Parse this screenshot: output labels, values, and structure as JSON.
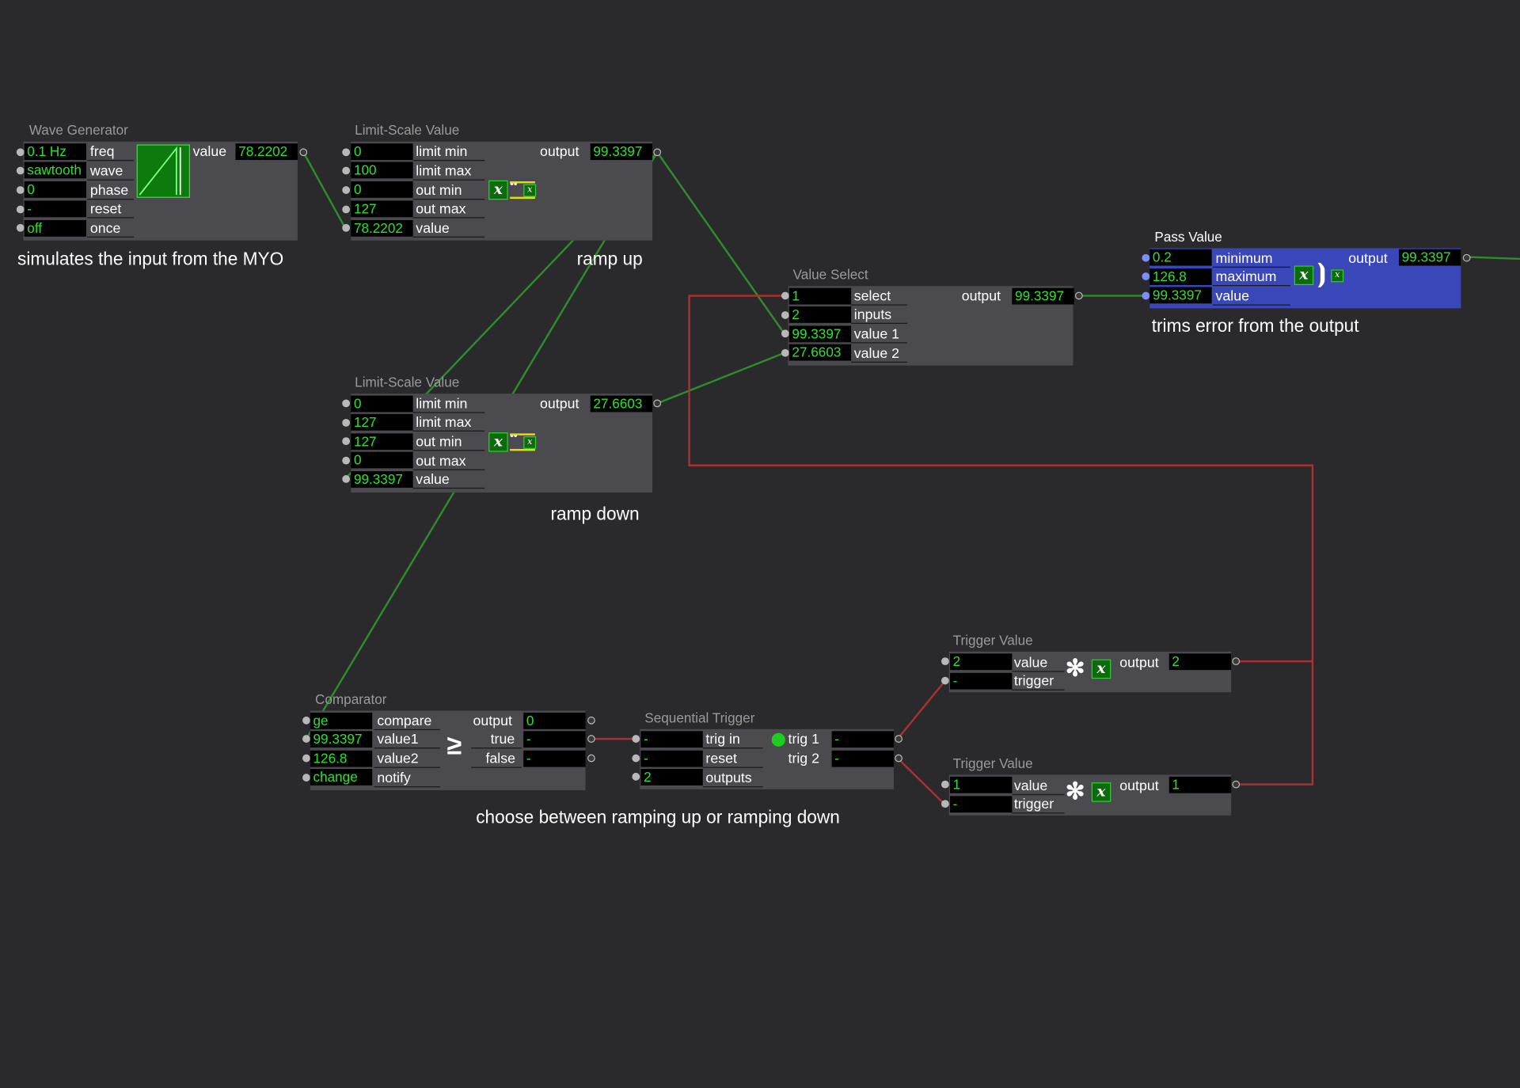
{
  "actors": {
    "wave_generator": {
      "title": "Wave Generator",
      "inputs": [
        {
          "value": "0.1 Hz",
          "label": "freq"
        },
        {
          "value": "sawtooth",
          "label": "wave"
        },
        {
          "value": "0",
          "label": "phase"
        },
        {
          "value": "-",
          "label": "reset"
        },
        {
          "value": "off",
          "label": "once"
        }
      ],
      "output": {
        "label": "value",
        "value": "78.2202"
      },
      "comment": "simulates the input from the MYO"
    },
    "limit_scale_up": {
      "title": "Limit-Scale Value",
      "inputs": [
        {
          "value": "0",
          "label": "limit min"
        },
        {
          "value": "100",
          "label": "limit max"
        },
        {
          "value": "0",
          "label": "out min"
        },
        {
          "value": "127",
          "label": "out max"
        },
        {
          "value": "78.2202",
          "label": "value"
        }
      ],
      "output": {
        "label": "output",
        "value": "99.3397"
      },
      "comment": "ramp up"
    },
    "limit_scale_down": {
      "title": "Limit-Scale Value",
      "inputs": [
        {
          "value": "0",
          "label": "limit min"
        },
        {
          "value": "127",
          "label": "limit max"
        },
        {
          "value": "127",
          "label": "out min"
        },
        {
          "value": "0",
          "label": "out max"
        },
        {
          "value": "99.3397",
          "label": "value"
        }
      ],
      "output": {
        "label": "output",
        "value": "27.6603"
      },
      "comment": "ramp down"
    },
    "value_select": {
      "title": "Value Select",
      "inputs": [
        {
          "value": "1",
          "label": "select"
        },
        {
          "value": "2",
          "label": "inputs"
        },
        {
          "value": "99.3397",
          "label": "value 1"
        },
        {
          "value": "27.6603",
          "label": "value 2"
        }
      ],
      "output": {
        "label": "output",
        "value": "99.3397"
      }
    },
    "pass_value": {
      "title": "Pass Value",
      "inputs": [
        {
          "value": "0.2",
          "label": "minimum"
        },
        {
          "value": "126.8",
          "label": "maximum"
        },
        {
          "value": "99.3397",
          "label": "value"
        }
      ],
      "output": {
        "label": "output",
        "value": "99.3397"
      },
      "comment": "trims error from the output"
    },
    "comparator": {
      "title": "Comparator",
      "inputs": [
        {
          "value": "ge",
          "label": "compare"
        },
        {
          "value": "99.3397",
          "label": "value1"
        },
        {
          "value": "126.8",
          "label": "value2"
        },
        {
          "value": "change",
          "label": "notify"
        }
      ],
      "outputs": [
        {
          "label": "output",
          "value": "0"
        },
        {
          "label": "true",
          "value": "-"
        },
        {
          "label": "false",
          "value": "-"
        }
      ],
      "symbol": "≥"
    },
    "sequential_trigger": {
      "title": "Sequential Trigger",
      "inputs": [
        {
          "value": "-",
          "label": "trig in"
        },
        {
          "value": "-",
          "label": "reset"
        },
        {
          "value": "2",
          "label": "outputs"
        }
      ],
      "outputs": [
        {
          "label": "trig 1",
          "value": "-"
        },
        {
          "label": "trig 2",
          "value": "-"
        }
      ],
      "comment": "choose between ramping up or ramping down"
    },
    "trigger_value_1": {
      "title": "Trigger Value",
      "inputs": [
        {
          "value": "2",
          "label": "value"
        },
        {
          "value": "-",
          "label": "trigger"
        }
      ],
      "output": {
        "label": "output",
        "value": "2"
      }
    },
    "trigger_value_2": {
      "title": "Trigger Value",
      "inputs": [
        {
          "value": "1",
          "label": "value"
        },
        {
          "value": "-",
          "label": "trigger"
        }
      ],
      "output": {
        "label": "output",
        "value": "1"
      }
    }
  },
  "icons": {
    "expression_button": "x-function-icon",
    "expression_small": "x-small-icon",
    "trigger_burst": "asterisk-burst-icon",
    "wave_preview": "sawtooth-wave-icon"
  },
  "colors": {
    "background": "#2a2a2c",
    "actor_body": "#4a4a4f",
    "selected_actor": "#3a47b8",
    "value_text": "#2fe02f",
    "green_wire": "#2e8b2e",
    "red_wire": "#a83232"
  }
}
